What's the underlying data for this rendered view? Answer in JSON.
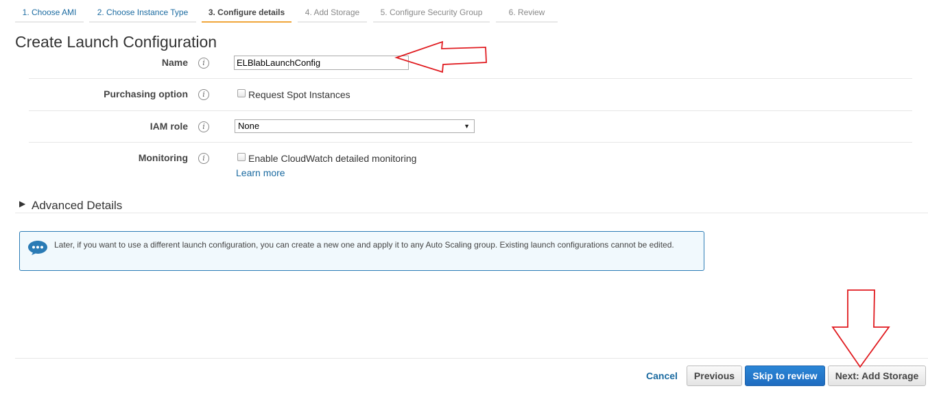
{
  "steps": [
    {
      "label": "1. Choose AMI",
      "state": "done"
    },
    {
      "label": "2. Choose Instance Type",
      "state": "done"
    },
    {
      "label": "3. Configure details",
      "state": "active"
    },
    {
      "label": "4. Add Storage",
      "state": "pending"
    },
    {
      "label": "5. Configure Security Group",
      "state": "pending"
    },
    {
      "label": "6. Review",
      "state": "pending"
    }
  ],
  "page_title": "Create Launch Configuration",
  "form": {
    "name": {
      "label": "Name",
      "value": "ELBlabLaunchConfig"
    },
    "purchasing": {
      "label": "Purchasing option",
      "checkbox_label": "Request Spot Instances",
      "checked": false
    },
    "iam_role": {
      "label": "IAM role",
      "selected": "None"
    },
    "monitoring": {
      "label": "Monitoring",
      "checkbox_label": "Enable CloudWatch detailed monitoring",
      "checked": false,
      "link": "Learn more"
    }
  },
  "advanced": {
    "title": "Advanced Details",
    "expanded": false
  },
  "info_message": "Later, if you want to use a different launch configuration, you can create a new one and apply it to any Auto Scaling group. Existing launch configurations cannot be edited.",
  "footer": {
    "cancel": "Cancel",
    "previous": "Previous",
    "skip": "Skip to review",
    "next": "Next: Add Storage"
  },
  "colors": {
    "link": "#1a6aa0",
    "active_step_underline": "#f0a63a",
    "primary_button": "#1f6cc0",
    "info_border": "#2a7bb5",
    "annotation_arrow": "#e0191e"
  },
  "icons": {
    "info": "info-icon",
    "caret": "caret-down-icon",
    "toggle": "caret-right-icon",
    "message": "chat-bubble-icon"
  }
}
